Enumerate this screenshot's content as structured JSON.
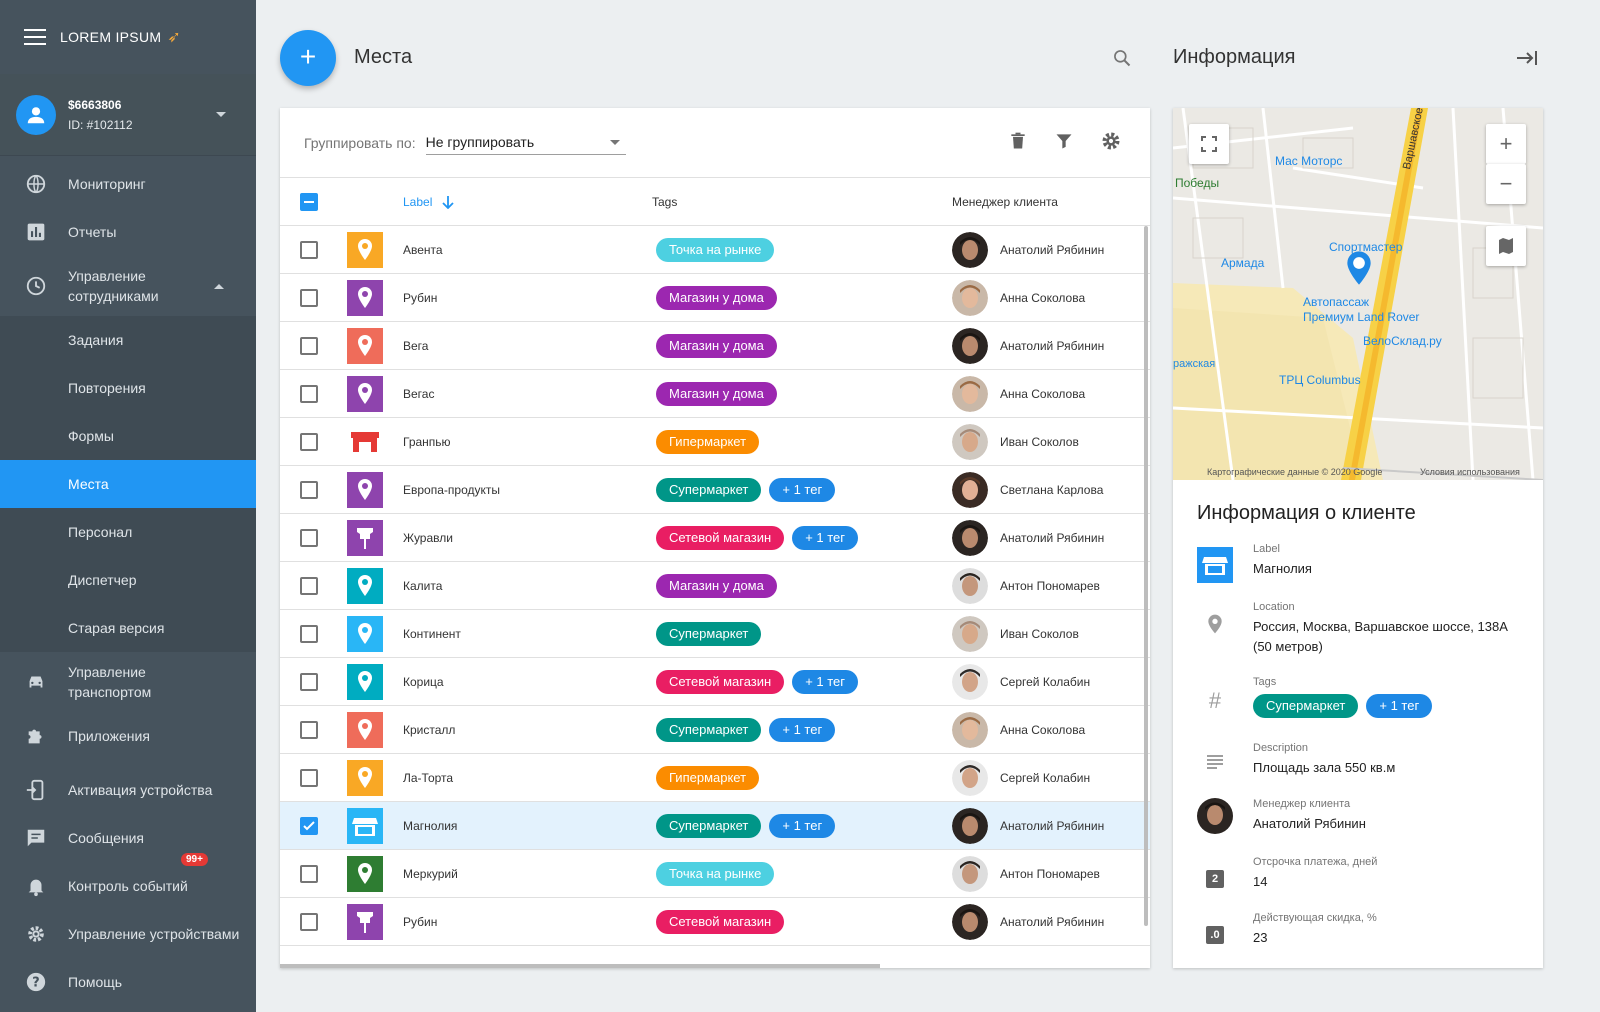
{
  "app": {
    "brand": "LOREM IPSUM"
  },
  "user": {
    "balance": "$6663806",
    "id": "ID: #102112"
  },
  "nav": {
    "monitoring": "Мониторинг",
    "reports": "Отчеты",
    "staff_mgmt": "Управление сотрудниками",
    "sub": [
      "Задания",
      "Повторения",
      "Формы",
      "Места",
      "Персонал",
      "Диспетчер",
      "Старая версия"
    ],
    "transport": "Управление транспортом",
    "apps": "Приложения",
    "activation": "Активация устройства",
    "messages": "Сообщения",
    "events": "Контроль событий",
    "events_badge": "99+",
    "devices": "Управление устройствами",
    "help": "Помощь"
  },
  "header": {
    "title": "Места",
    "info_title": "Информация",
    "fab_label": "+"
  },
  "toolbar": {
    "group_label": "Группировать по:",
    "group_value": "Не группировать"
  },
  "table": {
    "columns": {
      "label": "Label",
      "tags": "Tags",
      "manager": "Менеджер клиента"
    },
    "rows": [
      {
        "label": "Авента",
        "tags": [
          "Точка на рынке"
        ],
        "manager": "Анатолий Рябинин"
      },
      {
        "label": "Рубин",
        "tags": [
          "Магазин у дома"
        ],
        "manager": "Анна Соколова"
      },
      {
        "label": "Вега",
        "tags": [
          "Магазин у дома"
        ],
        "manager": "Анатолий Рябинин"
      },
      {
        "label": "Вегас",
        "tags": [
          "Магазин у дома"
        ],
        "manager": "Анна Соколова"
      },
      {
        "label": "Гранпью",
        "tags": [
          "Гипермаркет"
        ],
        "manager": "Иван Соколов"
      },
      {
        "label": "Европа-продукты",
        "tags": [
          "Супермаркет",
          "+ 1 тег"
        ],
        "manager": "Светлана Карлова"
      },
      {
        "label": "Журавли",
        "tags": [
          "Сетевой магазин",
          "+ 1 тег"
        ],
        "manager": "Анатолий Рябинин"
      },
      {
        "label": "Калита",
        "tags": [
          "Магазин у дома"
        ],
        "manager": "Антон Пономарев"
      },
      {
        "label": "Континент",
        "tags": [
          "Супермаркет"
        ],
        "manager": "Иван Соколов"
      },
      {
        "label": "Корица",
        "tags": [
          "Сетевой магазин",
          "+ 1 тег"
        ],
        "manager": "Сергей Колабин"
      },
      {
        "label": "Кристалл",
        "tags": [
          "Супермаркет",
          "+ 1 тег"
        ],
        "manager": "Анна Соколова"
      },
      {
        "label": "Ла-Торта",
        "tags": [
          "Гипермаркет"
        ],
        "manager": "Сергей Колабин"
      },
      {
        "label": "Магнолия",
        "tags": [
          "Супермаркет",
          "+ 1 тег"
        ],
        "manager": "Анатолий Рябинин"
      },
      {
        "label": "Меркурий",
        "tags": [
          "Точка на рынке"
        ],
        "manager": "Антон Пономарев"
      },
      {
        "label": "Рубин",
        "tags": [
          "Сетевой магазин"
        ],
        "manager": "Анатолий Рябинин"
      }
    ]
  },
  "map": {
    "labels": [
      "Мас Моторс",
      "Победы",
      "Спортмастер",
      "Армада",
      "Автопассаж",
      "Премиум Land Rover",
      "ВелоСклад.ру",
      "ТРЦ Columbus",
      "ражская",
      "Варшавское ш."
    ],
    "attribution": "Картографические данные © 2020 Google",
    "terms": "Условия использования",
    "zoom_in": "+",
    "zoom_out": "−"
  },
  "info": {
    "heading": "Информация о клиенте",
    "label_title": "Label",
    "label_value": "Магнолия",
    "location_title": "Location",
    "location_value": "Россия, Москва, Варшавское шоссе, 138А (50 метров)",
    "tags_title": "Tags",
    "tags": [
      "Супермаркет",
      "+ 1 тег"
    ],
    "desc_title": "Description",
    "desc_value": "Площадь зала 550 кв.м",
    "manager_title": "Менеджер клиента",
    "manager_value": "Анатолий Рябинин",
    "delay_title": "Отсрочка платежа, дней",
    "delay_value": "14",
    "discount_title": "Действующая скидка, %",
    "discount_value": "23"
  },
  "colors": {
    "accent": "#2196f3",
    "sidebar": "#46535d",
    "tag_market": "#4dd0e1",
    "tag_home": "#9c27b0",
    "tag_hyper": "#fb8c00",
    "tag_super": "#009688",
    "tag_chain": "#e91e63",
    "tag_more": "#1e88e5"
  }
}
